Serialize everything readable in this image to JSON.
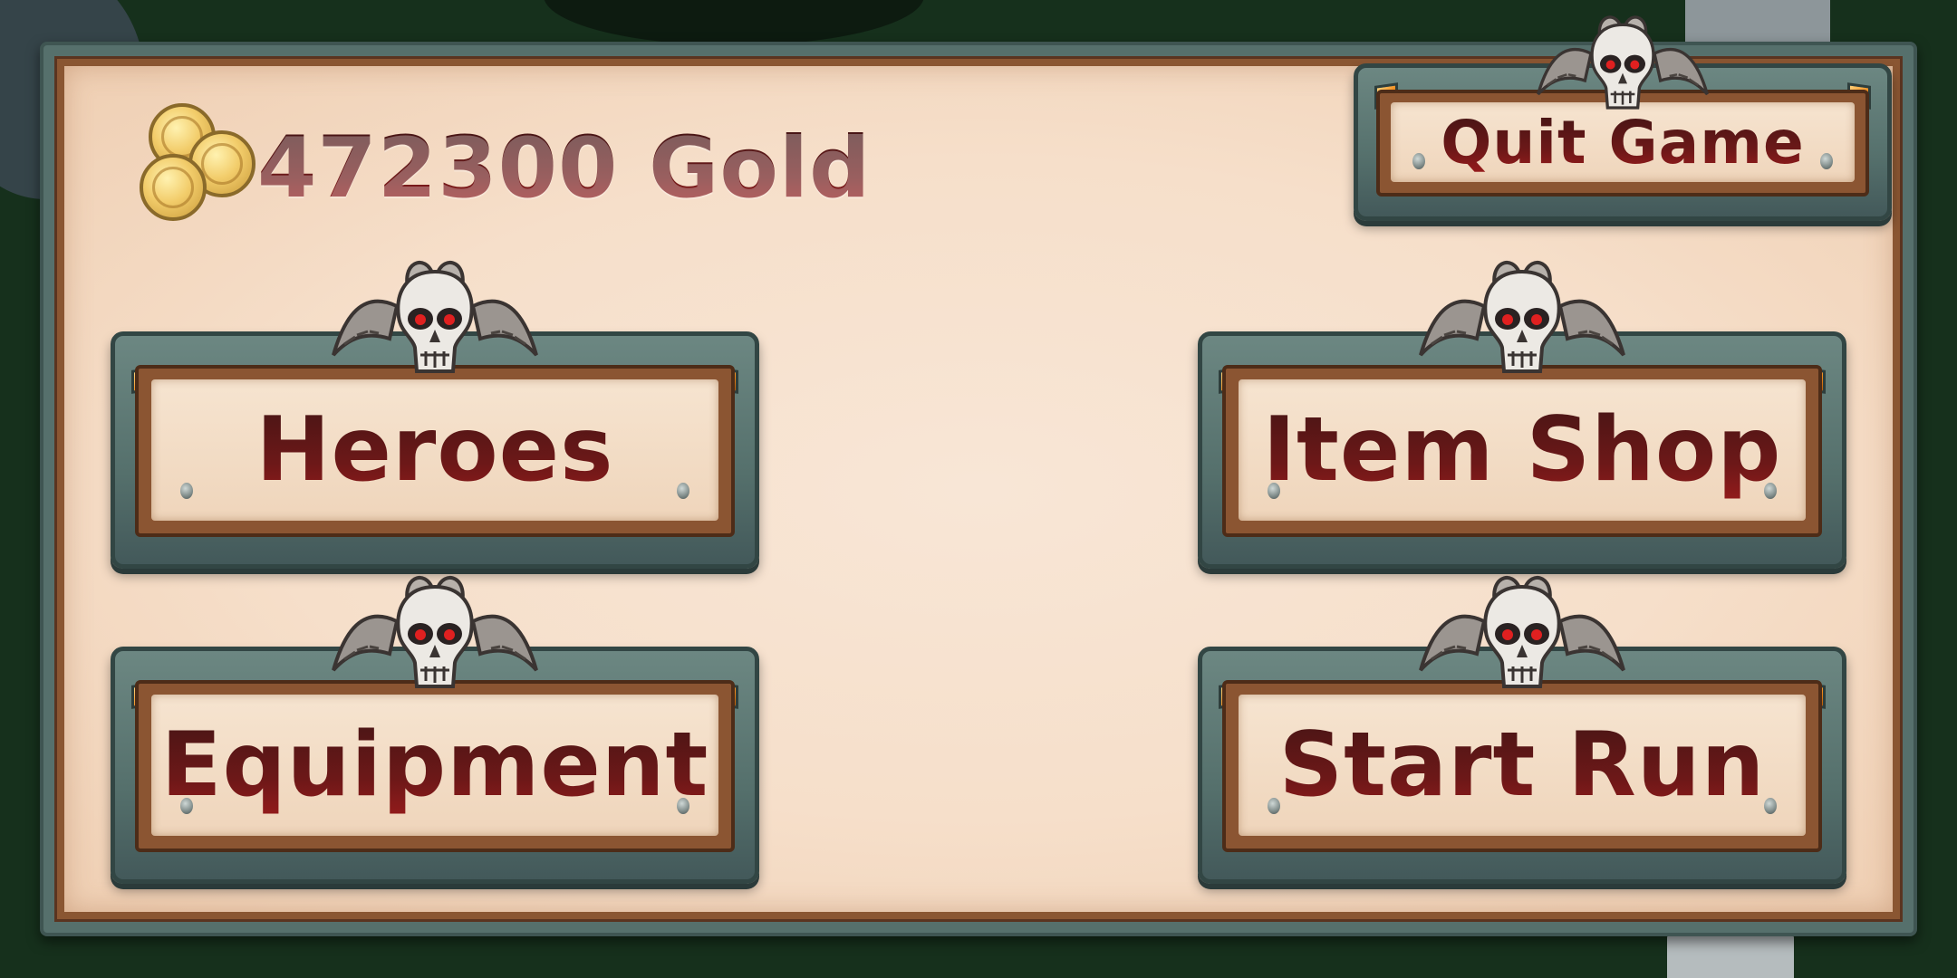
{
  "currency": {
    "amount": "472300",
    "unit": "Gold",
    "display": "472300 Gold",
    "icon": "gold-coins-icon"
  },
  "menu": {
    "quit_label": "Quit Game",
    "heroes_label": "Heroes",
    "item_shop_label": "Item Shop",
    "equipment_label": "Equipment",
    "start_run_label": "Start Run"
  },
  "ornament": {
    "icon": "horned-skull-icon"
  },
  "colors": {
    "parchment": "#f6dfca",
    "frame": "#56706c",
    "wood": "#8b5532",
    "text": "#6d1818",
    "gem": "#f08a1a",
    "background": "#16301c"
  }
}
